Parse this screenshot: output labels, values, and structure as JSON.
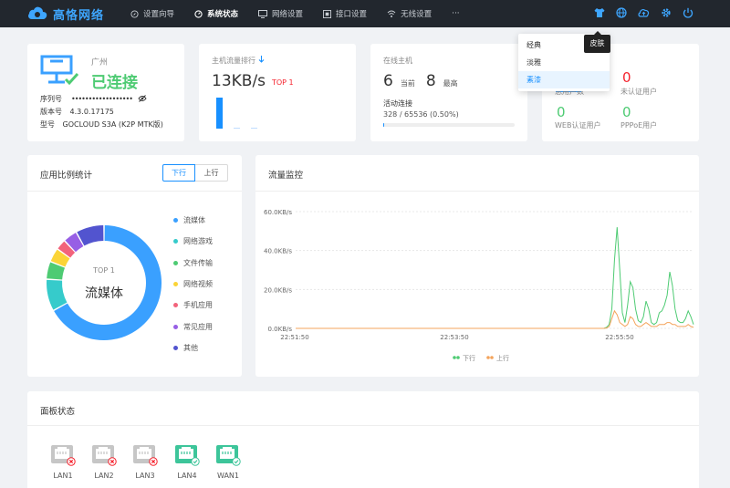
{
  "brand": {
    "name": "高恪网络"
  },
  "nav": {
    "items": [
      {
        "label": "设置向导"
      },
      {
        "label": "系统状态"
      },
      {
        "label": "网络设置"
      },
      {
        "label": "接口设置"
      },
      {
        "label": "无线设置"
      }
    ],
    "more": "···"
  },
  "skin_menu": {
    "tooltip": "皮肤",
    "options": [
      "经典",
      "淡雅",
      "素漆"
    ],
    "selected": "素漆"
  },
  "device": {
    "location": "广州",
    "status": "已连接",
    "serial_label": "序列号",
    "serial_value": "••••••••••••••••••",
    "version_label": "版本号",
    "version_value": "4.3.0.17175",
    "model_label": "型号",
    "model_value": "GOCLOUD S3A (K2P MTK版)"
  },
  "traffic_rank": {
    "title": "主机流量排行",
    "value": "13KB/s",
    "badge": "TOP 1"
  },
  "online_hosts": {
    "title": "在线主机",
    "current_value": "6",
    "current_label": "当前",
    "max_value": "8",
    "max_label": "最高",
    "active_label": "活动连接",
    "active_value": "328 / 65536 (0.50%)",
    "active_fraction": 0.005
  },
  "users": {
    "total_label": "总用户数",
    "unauth_value": "0",
    "unauth_label": "未认证用户",
    "web_value": "0",
    "web_label": "WEB认证用户",
    "pppoe_value": "0",
    "pppoe_label": "PPPoE用户"
  },
  "app_stats": {
    "title": "应用比例统计",
    "tab_down": "下行",
    "tab_up": "上行",
    "center_top": "TOP 1",
    "center_label": "流媒体",
    "slices": [
      {
        "name": "流媒体",
        "value": 67,
        "color": "#3aa0ff"
      },
      {
        "name": "网络游戏",
        "value": 9,
        "color": "#36cbcb"
      },
      {
        "name": "文件传输",
        "value": 5,
        "color": "#4ecb73"
      },
      {
        "name": "网络视频",
        "value": 4,
        "color": "#fbd437"
      },
      {
        "name": "手机应用",
        "value": 3,
        "color": "#f2637b"
      },
      {
        "name": "常见应用",
        "value": 4,
        "color": "#975fe5"
      },
      {
        "name": "其他",
        "value": 8,
        "color": "#5254cf"
      }
    ]
  },
  "traffic_monitor": {
    "title": "流量监控",
    "chart_data": {
      "type": "line",
      "x": [
        "22:51:50",
        "22:53:50",
        "22:55:50"
      ],
      "yticks": [
        "0.0KB/s",
        "20.0KB/s",
        "40.0KB/s",
        "60.0KB/s"
      ],
      "ylim": [
        0,
        60
      ],
      "series": [
        {
          "name": "下行",
          "color": "#4ecb73",
          "values": [
            0,
            0,
            0,
            0,
            0,
            0,
            0,
            0,
            0,
            0,
            0,
            0,
            0,
            0,
            0,
            0,
            0,
            0,
            0,
            0,
            0,
            0,
            0,
            0,
            0,
            0,
            0,
            0,
            0,
            0,
            0,
            0,
            0,
            0,
            0,
            0,
            0,
            0,
            0,
            0,
            0,
            0,
            0,
            0,
            0,
            0,
            0,
            0,
            0,
            0,
            0,
            0,
            0,
            0,
            0,
            0,
            0,
            0,
            0,
            0,
            0,
            0,
            0,
            0,
            0,
            0,
            0,
            0,
            0,
            0,
            0,
            0,
            0,
            0,
            0,
            0,
            0,
            0,
            0,
            0,
            0,
            0,
            0,
            0,
            0,
            0,
            0,
            0,
            0,
            0,
            0,
            0,
            0,
            0,
            0,
            0,
            0,
            0,
            0,
            0,
            0,
            0,
            0,
            0,
            0,
            0,
            0,
            0,
            0,
            0,
            0,
            0,
            0,
            0,
            0,
            0,
            0,
            0,
            0.5,
            2,
            10,
            35,
            52,
            30,
            8,
            3,
            12,
            24,
            21,
            10,
            4,
            3,
            6,
            14,
            10,
            3,
            2,
            3,
            8,
            9,
            12,
            17,
            29,
            22,
            10,
            4,
            3,
            3,
            5,
            9,
            6,
            2
          ]
        },
        {
          "name": "上行",
          "color": "#f4a45c",
          "values": [
            0,
            0,
            0,
            0,
            0,
            0,
            0,
            0,
            0,
            0,
            0,
            0,
            0,
            0,
            0,
            0,
            0,
            0,
            0,
            0,
            0,
            0,
            0,
            0,
            0,
            0,
            0,
            0,
            0,
            0,
            0,
            0,
            0,
            0,
            0,
            0,
            0,
            0,
            0,
            0,
            0,
            0,
            0,
            0,
            0,
            0,
            0,
            0,
            0,
            0,
            0,
            0,
            0,
            0,
            0,
            0,
            0,
            0,
            0,
            0,
            0,
            0,
            0,
            0,
            0,
            0,
            0,
            0,
            0,
            0,
            0,
            0,
            0,
            0,
            0,
            0,
            0,
            0,
            0,
            0,
            0,
            0,
            0,
            0,
            0,
            0,
            0,
            0,
            0,
            0,
            0,
            0,
            0,
            0,
            0,
            0,
            0,
            0,
            0,
            0,
            0,
            0,
            0,
            0,
            0,
            0,
            0,
            0,
            0,
            0,
            0,
            0,
            0,
            0,
            0,
            0,
            0,
            0,
            0.2,
            1,
            5,
            9,
            7,
            3,
            2,
            1,
            2,
            6,
            5,
            2,
            1,
            1,
            2,
            3,
            2,
            1,
            1,
            1,
            2,
            2,
            2,
            3,
            3,
            2,
            2,
            1,
            1,
            1,
            1,
            2,
            1,
            0.5
          ]
        }
      ]
    }
  },
  "panel": {
    "title": "面板状态",
    "ports": [
      {
        "label": "LAN1",
        "status": "down"
      },
      {
        "label": "LAN2",
        "status": "down"
      },
      {
        "label": "LAN3",
        "status": "down"
      },
      {
        "label": "LAN4",
        "status": "up"
      },
      {
        "label": "WAN1",
        "status": "up"
      }
    ]
  }
}
